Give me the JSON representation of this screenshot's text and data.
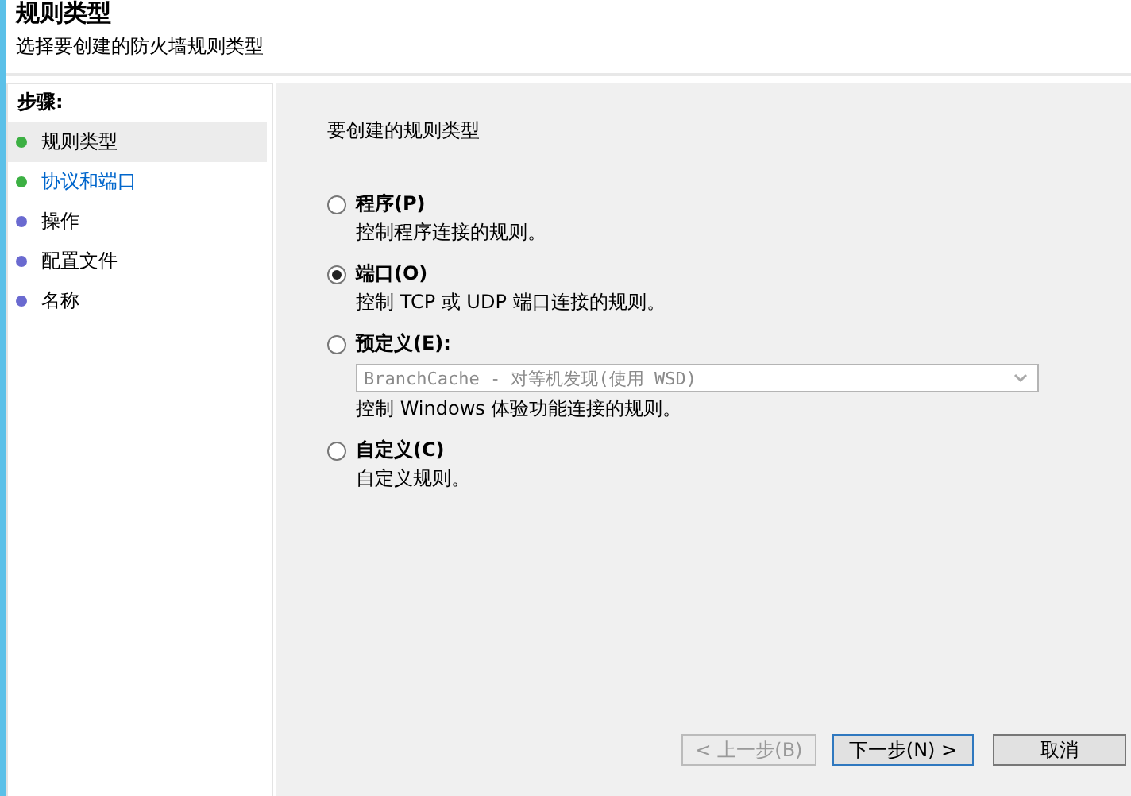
{
  "header": {
    "title": "规则类型",
    "subtitle": "选择要创建的防火墙规则类型"
  },
  "steps": {
    "heading": "步骤:",
    "items": [
      {
        "label": "规则类型",
        "color": "#3cb043",
        "selected": true,
        "highlighted": false
      },
      {
        "label": "协议和端口",
        "color": "#3cb043",
        "selected": false,
        "highlighted": true
      },
      {
        "label": "操作",
        "color": "#6a6ad0",
        "selected": false,
        "highlighted": false
      },
      {
        "label": "配置文件",
        "color": "#6a6ad0",
        "selected": false,
        "highlighted": false
      },
      {
        "label": "名称",
        "color": "#6a6ad0",
        "selected": false,
        "highlighted": false
      }
    ]
  },
  "content": {
    "prompt": "要创建的规则类型",
    "options": [
      {
        "label": "程序(P)",
        "description": "控制程序连接的规则。",
        "selected": false
      },
      {
        "label": "端口(O)",
        "description": "控制 TCP 或 UDP 端口连接的规则。",
        "selected": true
      },
      {
        "label": "预定义(E):",
        "description": "控制 Windows 体验功能连接的规则。",
        "selected": false,
        "dropdown": {
          "value": "BranchCache - 对等机发现(使用 WSD)",
          "disabled": true
        }
      },
      {
        "label": "自定义(C)",
        "description": "自定义规则。",
        "selected": false
      }
    ]
  },
  "buttons": [
    {
      "label": "< 上一步(B)",
      "disabled": true,
      "default": false
    },
    {
      "label": "下一步(N) >",
      "disabled": false,
      "default": true
    },
    {
      "label": "取消",
      "disabled": false,
      "default": false
    }
  ]
}
